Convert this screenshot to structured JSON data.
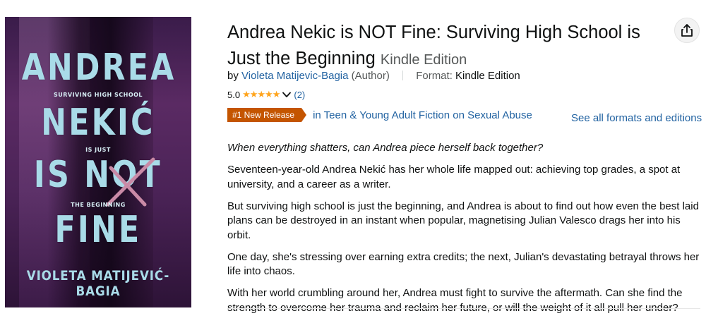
{
  "cover": {
    "line1": "ANDREA",
    "line2": "NEKIĆ",
    "line3": "IS NOT",
    "line4": "FINE",
    "tag1": "SURVIVING HIGH SCHOOL",
    "tag2": "IS JUST",
    "tag3": "THE BEGINNING",
    "author": "VIOLETA MATIJEVIĆ-BAGIA"
  },
  "product": {
    "title": "Andrea Nekic is NOT Fine: Surviving High School is Just the Beginning",
    "edition": "Kindle Edition"
  },
  "byline": {
    "by": "by",
    "author": "Violeta Matijevic-Bagia",
    "role": "(Author)",
    "format_label": "Format:",
    "format_value": "Kindle Edition"
  },
  "rating": {
    "score": "5.0",
    "stars": "★★★★★",
    "count": "(2)"
  },
  "badge": {
    "label": "#1 New Release",
    "category": "in Teen & Young Adult Fiction on Sexual Abuse"
  },
  "formats_link": "See all formats and editions",
  "description": {
    "lead": "When everything shatters, can Andrea piece herself back together?",
    "p1": "Seventeen-year-old Andrea Nekić has her whole life mapped out: achieving top grades, a spot at university, and a career as a writer.",
    "p2": "But surviving high school is just the beginning, and Andrea is about to find out how even the best laid plans can be destroyed in an instant when popular, magnetising Julian Valesco drags her into his orbit.",
    "p3": "One day, she's stressing over earning extra credits; the next, Julian's devastating betrayal throws her life into chaos.",
    "p4": "With her world crumbling around her, Andrea must fight to survive the aftermath. Can she find the strength to overcome her trauma and reclaim her future, or will the weight of it all pull her under?"
  },
  "colors": {
    "link": "#2162A1",
    "badge": "#C45500",
    "star": "#FFA41C"
  }
}
